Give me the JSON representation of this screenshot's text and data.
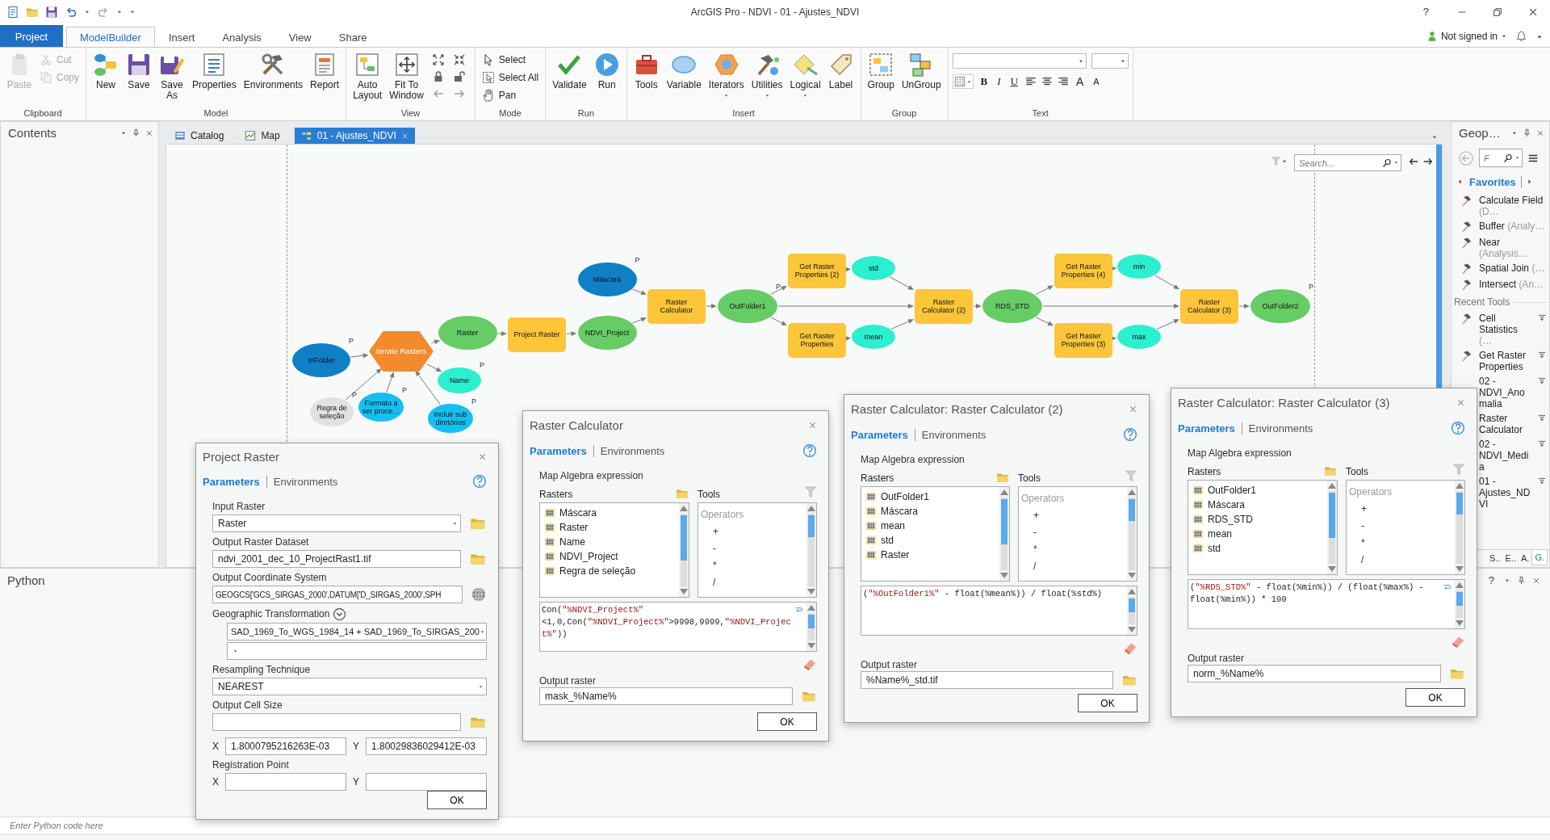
{
  "window": {
    "title": "ArcGIS Pro - NDVI - 01 - Ajustes_NDVI",
    "help": "?"
  },
  "ribbon_tabs": [
    {
      "label": "Project",
      "kind": "backstage",
      "selected": false
    },
    {
      "label": "ModelBuilder",
      "kind": "tab",
      "selected": true
    },
    {
      "label": "Insert",
      "kind": "tab",
      "selected": false
    },
    {
      "label": "Analysis",
      "kind": "tab",
      "selected": false
    },
    {
      "label": "View",
      "kind": "tab",
      "selected": false
    },
    {
      "label": "Share",
      "kind": "tab",
      "selected": false
    }
  ],
  "account": {
    "label": "Not signed in"
  },
  "ribbon_groups": [
    {
      "label": "Clipboard",
      "kind": "buttons",
      "items": [
        {
          "label": "Paste",
          "kind": "large",
          "disabled": true
        },
        {
          "label": "Cut",
          "kind": "small",
          "disabled": true
        },
        {
          "label": "Copy",
          "kind": "small",
          "disabled": true
        }
      ]
    },
    {
      "label": "Model",
      "kind": "buttons",
      "items": [
        {
          "label": "New",
          "kind": "large",
          "disabled": false
        },
        {
          "label": "Save",
          "kind": "large",
          "disabled": false
        },
        {
          "label": "Save\nAs",
          "kind": "large",
          "disabled": false
        },
        {
          "label": "Properties",
          "kind": "large",
          "disabled": false
        },
        {
          "label": "Environments",
          "kind": "large",
          "disabled": false
        },
        {
          "label": "Report",
          "kind": "large",
          "disabled": false
        }
      ]
    },
    {
      "label": "View",
      "kind": "buttons",
      "items": [
        {
          "label": "Auto\nLayout",
          "kind": "large",
          "disabled": false
        },
        {
          "label": "Fit To\nWindow",
          "kind": "large",
          "disabled": false
        },
        {
          "kind": "icon",
          "disabled": false
        },
        {
          "kind": "icon",
          "disabled": false
        },
        {
          "kind": "icon",
          "disabled": false
        },
        {
          "kind": "icon",
          "disabled": false
        },
        {
          "kind": "icon",
          "disabled": true
        },
        {
          "kind": "icon",
          "disabled": true
        }
      ]
    },
    {
      "label": "Mode",
      "kind": "buttons",
      "items": [
        {
          "label": "Select",
          "kind": "small",
          "disabled": false
        },
        {
          "label": "Select All",
          "kind": "small",
          "disabled": false
        },
        {
          "label": "Pan",
          "kind": "small",
          "disabled": false
        }
      ]
    },
    {
      "label": "Run",
      "kind": "buttons",
      "items": [
        {
          "label": "Validate",
          "kind": "large",
          "disabled": false
        },
        {
          "label": "Run",
          "kind": "large",
          "disabled": false
        }
      ]
    },
    {
      "label": "Insert",
      "kind": "buttons",
      "items": [
        {
          "label": "Tools",
          "kind": "large",
          "disabled": false
        },
        {
          "label": "Variable",
          "kind": "large",
          "disabled": false
        },
        {
          "label": "Iterators",
          "kind": "menu",
          "disabled": false
        },
        {
          "label": "Utilities",
          "kind": "menu",
          "disabled": false
        },
        {
          "label": "Logical",
          "kind": "menu",
          "disabled": false
        },
        {
          "label": "Label",
          "kind": "large",
          "disabled": false
        }
      ]
    },
    {
      "label": "Group",
      "kind": "buttons",
      "items": [
        {
          "label": "Group",
          "kind": "large",
          "disabled": false
        },
        {
          "label": "UnGroup",
          "kind": "large",
          "disabled": false
        }
      ]
    },
    {
      "label": "Text",
      "kind": "format",
      "items": [
        {
          "kind": "combo"
        },
        {
          "kind": "combo"
        },
        {
          "kind": "icon-menu"
        },
        {
          "kind": "glyph",
          "label": "B"
        },
        {
          "kind": "glyph",
          "label": "I"
        },
        {
          "kind": "glyph",
          "label": "U"
        },
        {
          "kind": "icon"
        },
        {
          "kind": "icon"
        },
        {
          "kind": "icon"
        },
        {
          "kind": "glyph",
          "label": "A"
        },
        {
          "kind": "glyph",
          "label": "A"
        }
      ]
    }
  ],
  "contents": {
    "title": "Contents"
  },
  "doc_tabs": [
    {
      "label": "Catalog",
      "selected": false
    },
    {
      "label": "Map",
      "selected": false
    },
    {
      "label": "01 - Ajustes_NDVI",
      "selected": true
    }
  ],
  "canvas": {
    "search": {
      "placeholder": "Search..."
    }
  },
  "model": {
    "nodes": [
      {
        "label": "InFolder",
        "kind": "dataset",
        "tag": "P"
      },
      {
        "label": "Iterate Rasters",
        "kind": "iterator"
      },
      {
        "label": "Raster",
        "kind": "derived"
      },
      {
        "label": "Name",
        "kind": "value",
        "tag": "P"
      },
      {
        "label": "Regra de seleção",
        "kind": "unset",
        "tag": "P"
      },
      {
        "label": "Formato a ser proce…",
        "kind": "parameter",
        "tag": "P"
      },
      {
        "label": "Incluir sub diretórios",
        "kind": "parameter",
        "tag": "P"
      },
      {
        "label": "Project Raster",
        "kind": "tool"
      },
      {
        "label": "NDVI_Project",
        "kind": "derived"
      },
      {
        "label": "Máscara",
        "kind": "dataset",
        "tag": "P"
      },
      {
        "label": "Raster Calculator",
        "kind": "tool"
      },
      {
        "label": "OutFolder1",
        "kind": "derived",
        "tag": "P"
      },
      {
        "label": "Get Raster Properties (2)",
        "kind": "tool"
      },
      {
        "label": "std",
        "kind": "value"
      },
      {
        "label": "Get Raster Properties",
        "kind": "tool"
      },
      {
        "label": "mean",
        "kind": "value"
      },
      {
        "label": "Raster Calculator (2)",
        "kind": "tool"
      },
      {
        "label": "RDS_STD",
        "kind": "derived"
      },
      {
        "label": "Get Raster Properties (4)",
        "kind": "tool"
      },
      {
        "label": "min",
        "kind": "value"
      },
      {
        "label": "Get Raster Properties (3)",
        "kind": "tool"
      },
      {
        "label": "max",
        "kind": "value"
      },
      {
        "label": "Raster Calculator (3)",
        "kind": "tool"
      },
      {
        "label": "OutFolder2",
        "kind": "derived",
        "tag": "P"
      }
    ]
  },
  "geoprocessing": {
    "title": "Geop…",
    "search": {
      "placeholder": "F"
    },
    "tab": "Favorites",
    "favorites": [
      {
        "name": "Calculate Field",
        "detail": "(D…"
      },
      {
        "name": "Buffer",
        "detail": "(Analy…"
      },
      {
        "name": "Near",
        "detail": "(Analysis…"
      },
      {
        "name": "Spatial Join",
        "detail": "(…"
      },
      {
        "name": "Intersect",
        "detail": "(An…"
      }
    ],
    "recent_heading": "Recent Tools",
    "recent": [
      {
        "name": "Cell Statistics",
        "detail": "(…",
        "shows_icon": true
      },
      {
        "name": "Get Raster Properties",
        "shows_icon": true
      },
      {
        "name": "02 - NDVI_Anomalia",
        "shows_icon": false
      },
      {
        "name": "Raster Calculator",
        "shows_icon": false
      },
      {
        "name": "02 - NDVI_Media",
        "shows_icon": false
      },
      {
        "name": "01 - Ajustes_NDVI",
        "shows_icon": false
      }
    ],
    "bottom_tabs": [
      {
        "label": "S..",
        "selected": false
      },
      {
        "label": "E..",
        "selected": false
      },
      {
        "label": "A.",
        "selected": false
      },
      {
        "label": "G.",
        "selected": true
      }
    ]
  },
  "python": {
    "title": "Python",
    "help": "?",
    "input": {
      "placeholder": "Enter Python code here"
    }
  },
  "dialogs": [
    {
      "kind": "project_raster",
      "title": "Project Raster",
      "tabs": [
        {
          "label": "Parameters",
          "selected": true
        },
        {
          "label": "Environments",
          "selected": false
        }
      ],
      "fields": [
        {
          "kind": "dropdown",
          "label": "Input Raster",
          "value": "Raster",
          "browse": true
        },
        {
          "kind": "text",
          "label": "Output Raster Dataset",
          "value": "ndvi_2001_dec_10_ProjectRast1.tif",
          "browse": true
        },
        {
          "kind": "coordsys",
          "label": "Output Coordinate System",
          "value": "GEOGCS['GCS_SIRGAS_2000',DATUM['D_SIRGAS_2000',SPH"
        },
        {
          "kind": "transform",
          "label": "Geographic Transformation",
          "value": "SAD_1969_To_WGS_1984_14 + SAD_1969_To_SIRGAS_200",
          "extra_row": true
        },
        {
          "kind": "dropdown",
          "label": "Resampling Technique",
          "value": "NEAREST",
          "browse": false
        },
        {
          "kind": "cellsize",
          "label": "Output Cell Size",
          "browse": true,
          "x_label": "X",
          "x": "1.8000795216263E-03",
          "y_label": "Y",
          "y": "1.80029836029412E-03"
        },
        {
          "kind": "xy",
          "label": "Registration Point",
          "x_label": "X",
          "y_label": "Y"
        }
      ],
      "ok": "OK"
    },
    {
      "kind": "raster_calculator",
      "title": "Raster Calculator",
      "tabs": [
        {
          "label": "Parameters",
          "selected": true
        },
        {
          "label": "Environments",
          "selected": false
        }
      ],
      "expression_label": "Map Algebra expression",
      "rasters_label": "Rasters",
      "rasters": [
        "Máscara",
        "Raster",
        "Name",
        "NDVI_Project",
        "Regra de seleção"
      ],
      "tools_label": "Tools",
      "operators_label": "Operators",
      "operators": [
        "+",
        "-",
        "*",
        "/"
      ],
      "expression": [
        {
          "kind": "plain",
          "text": "Con("
        },
        {
          "kind": "string",
          "text": "\"%NDVI_Project%\""
        },
        {
          "kind": "plain",
          "text": "<1,0,Con("
        },
        {
          "kind": "string",
          "text": "\"%NDVI_Project%\""
        },
        {
          "kind": "plain",
          "text": ">9998,9999,"
        },
        {
          "kind": "string",
          "text": "\"%NDVI_Project%\""
        },
        {
          "kind": "plain",
          "text": "))"
        }
      ],
      "word_wrap": true,
      "output_label": "Output raster",
      "output": "mask_%Name%",
      "ok": "OK"
    },
    {
      "kind": "raster_calculator",
      "title": "Raster Calculator: Raster Calculator (2)",
      "tabs": [
        {
          "label": "Parameters",
          "selected": true
        },
        {
          "label": "Environments",
          "selected": false
        }
      ],
      "expression_label": "Map Algebra expression",
      "rasters_label": "Rasters",
      "rasters": [
        "OutFolder1",
        "Máscara",
        "mean",
        "std",
        "Raster"
      ],
      "tools_label": "Tools",
      "operators_label": "Operators",
      "operators": [
        "+",
        "-",
        "*",
        "/"
      ],
      "expression": [
        {
          "kind": "plain",
          "text": "("
        },
        {
          "kind": "string",
          "text": "\"%OutFolder1%\""
        },
        {
          "kind": "plain",
          "text": " - float(%mean%)) / float(%std%)"
        }
      ],
      "word_wrap": false,
      "output_label": "Output raster",
      "output": "%Name%_std.tif",
      "ok": "OK"
    },
    {
      "kind": "raster_calculator",
      "title": "Raster Calculator: Raster Calculator (3)",
      "tabs": [
        {
          "label": "Parameters",
          "selected": true
        },
        {
          "label": "Environments",
          "selected": false
        }
      ],
      "expression_label": "Map Algebra expression",
      "rasters_label": "Rasters",
      "rasters": [
        "OutFolder1",
        "Máscara",
        "RDS_STD",
        "mean",
        "std"
      ],
      "tools_label": "Tools",
      "operators_label": "Operators",
      "operators": [
        "+",
        "-",
        "*",
        "/"
      ],
      "expression": [
        {
          "kind": "plain",
          "text": "("
        },
        {
          "kind": "string",
          "text": "\"%RDS_STD%\""
        },
        {
          "kind": "plain",
          "text": " - float(%min%)) / (float(%max%) - float(%min%)) * 100"
        }
      ],
      "word_wrap": true,
      "output_label": "Output raster",
      "output": "norm_%Name%",
      "ok": "OK"
    }
  ]
}
